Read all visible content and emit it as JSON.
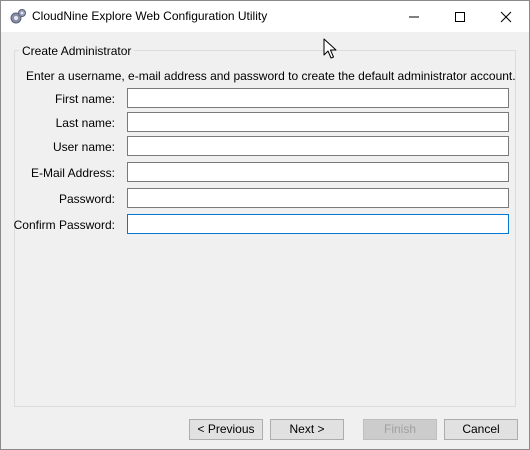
{
  "window": {
    "title": "CloudNine Explore Web Configuration Utility",
    "icon": "gear-cog-icon"
  },
  "group": {
    "label": "Create Administrator",
    "instructions": "Enter a username, e-mail address and password to create the default administrator account."
  },
  "fields": [
    {
      "label": "First name:",
      "value": ""
    },
    {
      "label": "Last name:",
      "value": ""
    },
    {
      "label": "User name:",
      "value": ""
    },
    {
      "label": "E-Mail Address:",
      "value": ""
    },
    {
      "label": "Password:",
      "value": ""
    },
    {
      "label": "Confirm Password:",
      "value": ""
    }
  ],
  "buttons": {
    "previous": "< Previous",
    "next": "Next >",
    "finish": "Finish",
    "cancel": "Cancel"
  },
  "colors": {
    "focus_border": "#0078d7",
    "window_bg": "#f0f0f0"
  }
}
